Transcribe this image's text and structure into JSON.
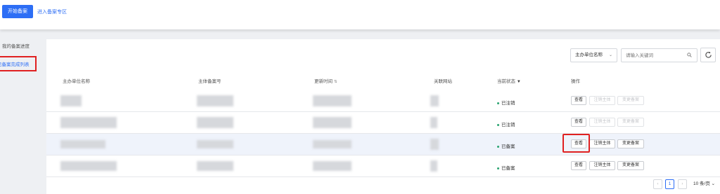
{
  "toolbar": {
    "start_button": "开始备案",
    "zone_link": "进入备案专区"
  },
  "sidebar": {
    "items": [
      {
        "label": "我的备案进度"
      },
      {
        "label": "已备案完成列表"
      }
    ]
  },
  "filter": {
    "select_value": "主办单位名称",
    "search_placeholder": "请输入关键词"
  },
  "table": {
    "columns": [
      "主办单位名称",
      "主体备案号",
      "更新时间",
      "关联网站",
      "当前状态",
      "操作"
    ],
    "rows": [
      {
        "status": "已注销",
        "actions": {
          "view": "查看",
          "cancel": "注销主体",
          "change": "变更备案"
        },
        "enabled": false
      },
      {
        "status": "已注销",
        "actions": {
          "view": "查看",
          "cancel": "注销主体",
          "change": "变更备案"
        },
        "enabled": false
      },
      {
        "status": "已备案",
        "actions": {
          "view": "查看",
          "cancel": "注销主体",
          "change": "变更备案"
        },
        "enabled": true
      },
      {
        "status": "已备案",
        "actions": {
          "view": "查看",
          "cancel": "注销主体",
          "change": "变更备案"
        },
        "enabled": true
      }
    ]
  },
  "pagination": {
    "prev": "‹",
    "current_page": "1",
    "next": "›",
    "page_size": "10 条/页"
  },
  "colors": {
    "accent": "#2d6ef5",
    "highlight": "#e02020",
    "status_dot": "#2ba471"
  },
  "icons": [
    "search-icon",
    "refresh-icon",
    "chevron-down-icon",
    "sort-icon",
    "filter-icon"
  ]
}
